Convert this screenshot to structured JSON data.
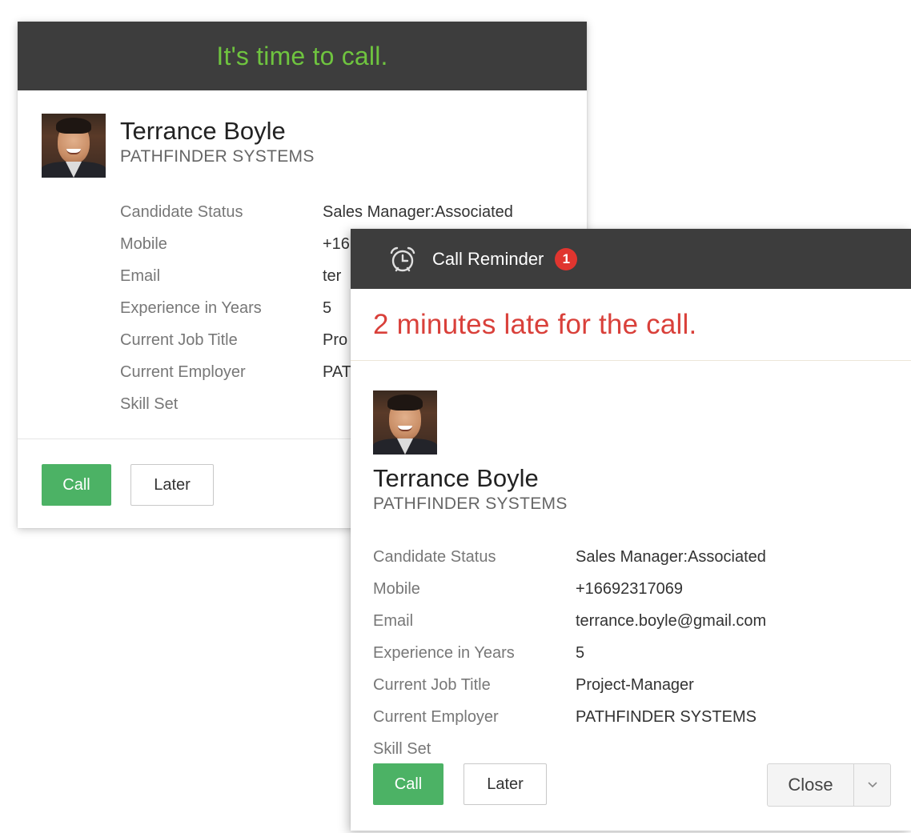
{
  "card1": {
    "header_title": "It's time to call.",
    "contact": {
      "name": "Terrance Boyle",
      "company": "PATHFINDER SYSTEMS"
    },
    "fields": [
      {
        "label": "Candidate Status",
        "value": "Sales Manager:Associated"
      },
      {
        "label": "Mobile",
        "value": "+16"
      },
      {
        "label": "Email",
        "value": "ter"
      },
      {
        "label": "Experience in Years",
        "value": "5"
      },
      {
        "label": "Current Job Title",
        "value": "Pro"
      },
      {
        "label": "Current Employer",
        "value": "PAT"
      },
      {
        "label": "Skill Set",
        "value": ""
      }
    ],
    "call_label": "Call",
    "later_label": "Later"
  },
  "card2": {
    "icon": "alarm-clock-icon",
    "title": "Call Reminder",
    "badge_count": "1",
    "late_message": "2 minutes late for the call.",
    "contact": {
      "name": "Terrance Boyle",
      "company": "PATHFINDER SYSTEMS"
    },
    "fields": [
      {
        "label": "Candidate Status",
        "value": "Sales Manager:Associated"
      },
      {
        "label": "Mobile",
        "value": "+16692317069"
      },
      {
        "label": "Email",
        "value": "terrance.boyle@gmail.com"
      },
      {
        "label": "Experience in Years",
        "value": "5"
      },
      {
        "label": "Current Job Title",
        "value": "Project-Manager"
      },
      {
        "label": "Current Employer",
        "value": "PATHFINDER SYSTEMS"
      },
      {
        "label": "Skill Set",
        "value": ""
      }
    ],
    "call_label": "Call",
    "later_label": "Later",
    "close_label": "Close"
  },
  "colors": {
    "header_bg": "#3d3d3d",
    "header_title": "#6fc43f",
    "call_button": "#4cb265",
    "late_text": "#d9403a",
    "badge": "#e0352f"
  }
}
